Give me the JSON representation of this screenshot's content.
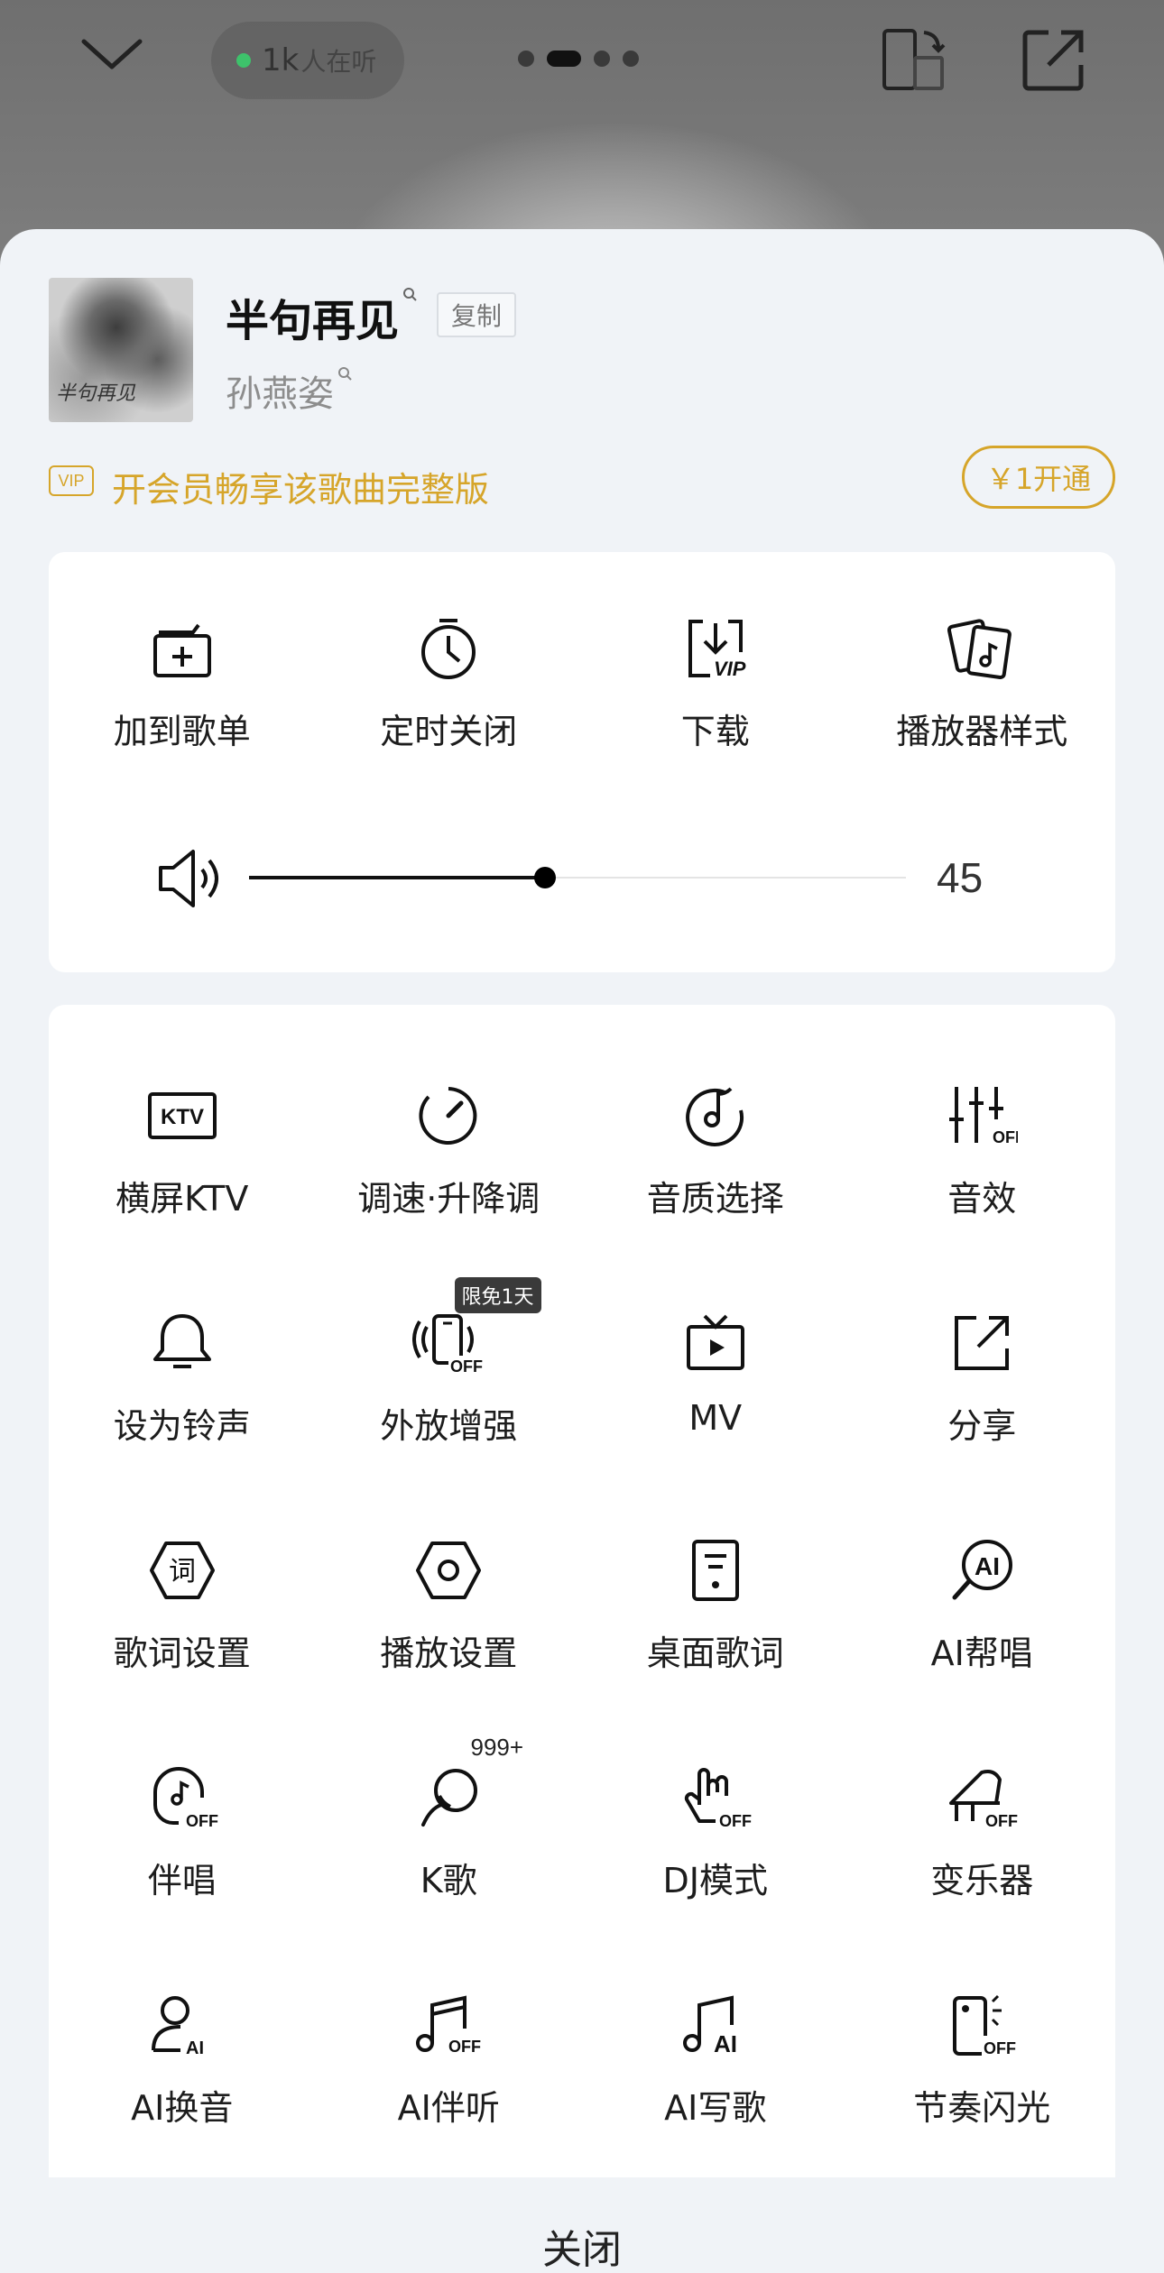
{
  "header": {
    "listeners_count": "1k",
    "listeners_suffix": "人在听",
    "pages": 4,
    "active_page": 2
  },
  "song": {
    "title": "半句再见",
    "copy_label": "复制",
    "artist": "孙燕姿",
    "cover_text": "半句再见"
  },
  "vip": {
    "badge": "VIP",
    "text": "开会员畅享该歌曲完整版",
    "open_label": "￥1开通"
  },
  "quick_actions": [
    {
      "label": "加到歌单",
      "icon": "add-to-playlist-icon"
    },
    {
      "label": "定时关闭",
      "icon": "timer-icon"
    },
    {
      "label": "下载",
      "icon": "vip-download-icon"
    },
    {
      "label": "播放器样式",
      "icon": "player-style-icon"
    }
  ],
  "volume": {
    "value": "45",
    "level": 0.45
  },
  "features": [
    {
      "label": "横屏KTV",
      "icon": "ktv-icon"
    },
    {
      "label": "调速·升降调",
      "icon": "speed-dial-icon"
    },
    {
      "label": "音质选择",
      "icon": "sound-quality-icon"
    },
    {
      "label": "音效",
      "icon": "equalizer-icon"
    },
    {
      "label": "设为铃声",
      "icon": "bell-icon"
    },
    {
      "label": "外放增强",
      "icon": "speaker-boost-icon",
      "badge": "限免1天"
    },
    {
      "label": "MV",
      "icon": "mv-tv-icon"
    },
    {
      "label": "分享",
      "icon": "share-icon"
    },
    {
      "label": "歌词设置",
      "icon": "lyrics-settings-icon"
    },
    {
      "label": "播放设置",
      "icon": "play-settings-icon"
    },
    {
      "label": "桌面歌词",
      "icon": "desktop-lyrics-icon"
    },
    {
      "label": "AI帮唱",
      "icon": "ai-sing-icon"
    },
    {
      "label": "伴唱",
      "icon": "backing-vocal-icon"
    },
    {
      "label": "K歌",
      "icon": "karaoke-mic-icon",
      "badge": "999+"
    },
    {
      "label": "DJ模式",
      "icon": "dj-hand-icon"
    },
    {
      "label": "变乐器",
      "icon": "piano-icon"
    },
    {
      "label": "AI换音",
      "icon": "ai-voice-icon"
    },
    {
      "label": "AI伴听",
      "icon": "ai-listen-icon"
    },
    {
      "label": "AI写歌",
      "icon": "ai-write-icon"
    },
    {
      "label": "节奏闪光",
      "icon": "rhythm-flash-icon"
    }
  ],
  "close_label": "关闭"
}
